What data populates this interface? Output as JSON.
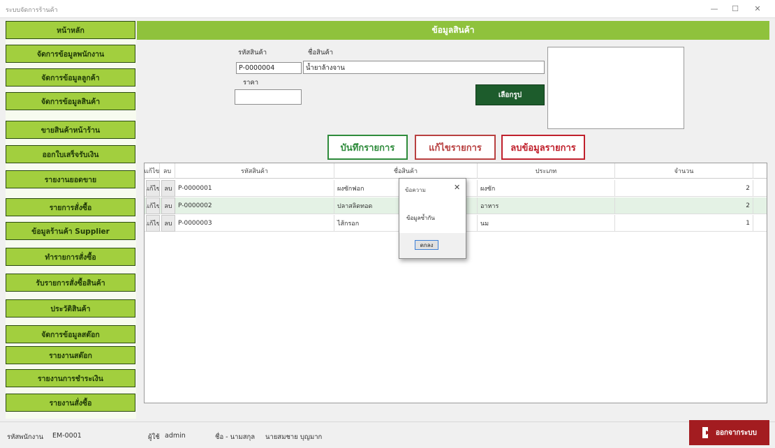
{
  "window": {
    "title": "ระบบจัดการร้านค้า",
    "controls": {
      "minimize": "—",
      "maximize": "☐",
      "close": "✕"
    }
  },
  "sidebar": {
    "items": [
      {
        "label": "หน้าหลัก"
      },
      {
        "label": "จัดการข้อมูลพนักงาน"
      },
      {
        "label": "จัดการข้อมูลลูกค้า"
      },
      {
        "label": "จัดการข้อมูลสินค้า"
      },
      {
        "label": "ขายสินค้าหน้าร้าน"
      },
      {
        "label": "ออกใบเสร็จรับเงิน"
      },
      {
        "label": "รายงานยอดขาย"
      },
      {
        "label": "รายการสั่งซื้อ"
      },
      {
        "label": "ข้อมูลร้านค้า Supplier"
      },
      {
        "label": "ทำรายการสั่งซื้อ"
      },
      {
        "label": "รับรายการสั่งซื้อสินค้า"
      },
      {
        "label": "ประวัติสินค้า"
      },
      {
        "label": "จัดการข้อมูลสต๊อก"
      },
      {
        "label": "รายงานสต๊อก"
      },
      {
        "label": "รายงานการชำระเงิน"
      },
      {
        "label": "รายงานสั่งซื้อ"
      }
    ]
  },
  "header": {
    "title": "ข้อมูลสินค้า"
  },
  "form": {
    "code_label": "รหัสสินค้า",
    "code_value": "P-0000004",
    "name_label": "ชื่อสินค้า",
    "name_value": "น้ำยาล้างจาน",
    "price_label": "ราคา",
    "price_value": "",
    "select_image_label": "เลือกรูป"
  },
  "actions": {
    "save": "บันทึกรายการ",
    "edit": "แก้ไขรายการ",
    "delete": "ลบข้อมูลรายการ"
  },
  "table": {
    "columns": [
      "แก้ไข",
      "ลบ",
      "รหัสสินค้า",
      "ชื่อสินค้า",
      "ประเภท",
      "จำนวน"
    ],
    "rows": [
      {
        "edit": "แก้ไข",
        "del": "ลบ",
        "code": "P-0000001",
        "name": "ผงซักฟอก",
        "type": "ผงซัก",
        "qty": "2"
      },
      {
        "edit": "แก้ไข",
        "del": "ลบ",
        "code": "P-0000002",
        "name": "ปลาสลิดทอด",
        "type": "อาหาร",
        "qty": "2"
      },
      {
        "edit": "แก้ไข",
        "del": "ลบ",
        "code": "P-0000003",
        "name": "ไส้กรอก",
        "type": "นม",
        "qty": "1"
      }
    ]
  },
  "dialog": {
    "title": "ข้อความ",
    "message": "ข้อมูลซ้ำกัน",
    "ok_label": "ตกลง",
    "close_glyph": "✕"
  },
  "statusbar": {
    "employee_label": "รหัสพนักงาน",
    "employee_value": "EM-0001",
    "user_label": "ผู้ใช้",
    "user_value": "admin",
    "name_label": "ชื่อ - นามสกุล",
    "name_value": "นายสมชาย บุญมาก",
    "logout_label": "ออกจากระบบ"
  },
  "colors": {
    "nav_green": "#a2cf3e",
    "header_green": "#8fc23c",
    "select_button": "#1d5c2c",
    "logout_red": "#a31c20"
  },
  "icons": {
    "logout": "logout-arrow-icon"
  }
}
